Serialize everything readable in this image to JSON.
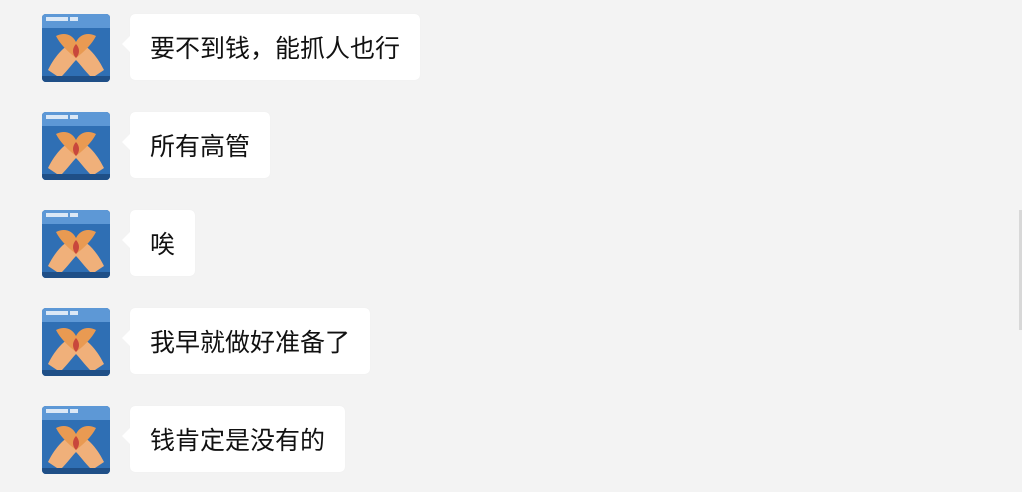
{
  "chat": {
    "messages": [
      {
        "text": "要不到钱，能抓人也行",
        "avatar_icon": "heart-hands-avatar"
      },
      {
        "text": "所有高管",
        "avatar_icon": "heart-hands-avatar"
      },
      {
        "text": "唉",
        "avatar_icon": "heart-hands-avatar"
      },
      {
        "text": "我早就做好准备了",
        "avatar_icon": "heart-hands-avatar"
      },
      {
        "text": "钱肯定是没有的",
        "avatar_icon": "heart-hands-avatar"
      }
    ]
  },
  "colors": {
    "background": "#f3f3f3",
    "bubble": "#ffffff",
    "text": "#111111",
    "avatar_blue": "#2f6fb4",
    "avatar_orange": "#e99a52"
  }
}
